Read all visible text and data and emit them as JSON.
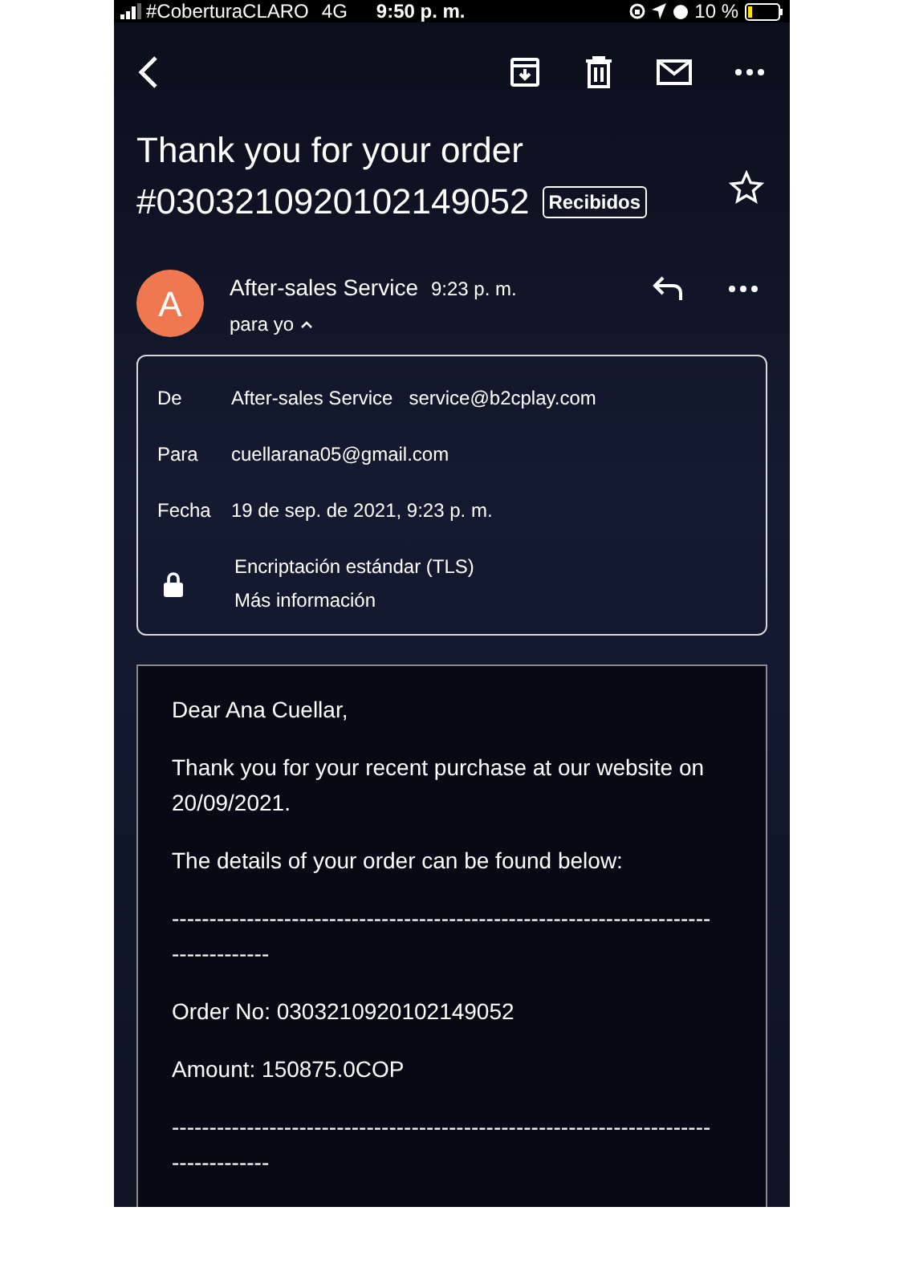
{
  "status_bar": {
    "carrier": "#CoberturaCLARO",
    "network": "4G",
    "time": "9:50 p. m.",
    "battery": "10 %"
  },
  "subject": {
    "line1": "Thank you for your order",
    "line2": "#0303210920102149052",
    "label": "Recibidos",
    "starred": false
  },
  "message": {
    "avatar": "A",
    "sender": "After-sales Service",
    "time": "9:23 p. m.",
    "recipient_summary": "para yo",
    "details_expanded": true
  },
  "details": [
    {
      "label": "De",
      "value": "After-sales Service",
      "extra": "service@b2cplay.com"
    },
    {
      "label": "Para",
      "value": "cuellarana05@gmail.com"
    },
    {
      "label": "Fecha",
      "value": "19 de sep. de 2021, 9:23 p. m."
    }
  ],
  "encryption": {
    "title": "Encriptación estándar (TLS)",
    "link": "Más información"
  },
  "body": [
    "Dear Ana Cuellar,",
    "Thank you for your recent purchase at our website on 20/09/2021.",
    "The details of your order can be found below:",
    "-------------------------------------------------------------------------------------",
    "Order No: 0303210920102149052",
    "Amount: 150875.0COP",
    "-------------------------------------------------------------------------------------"
  ]
}
